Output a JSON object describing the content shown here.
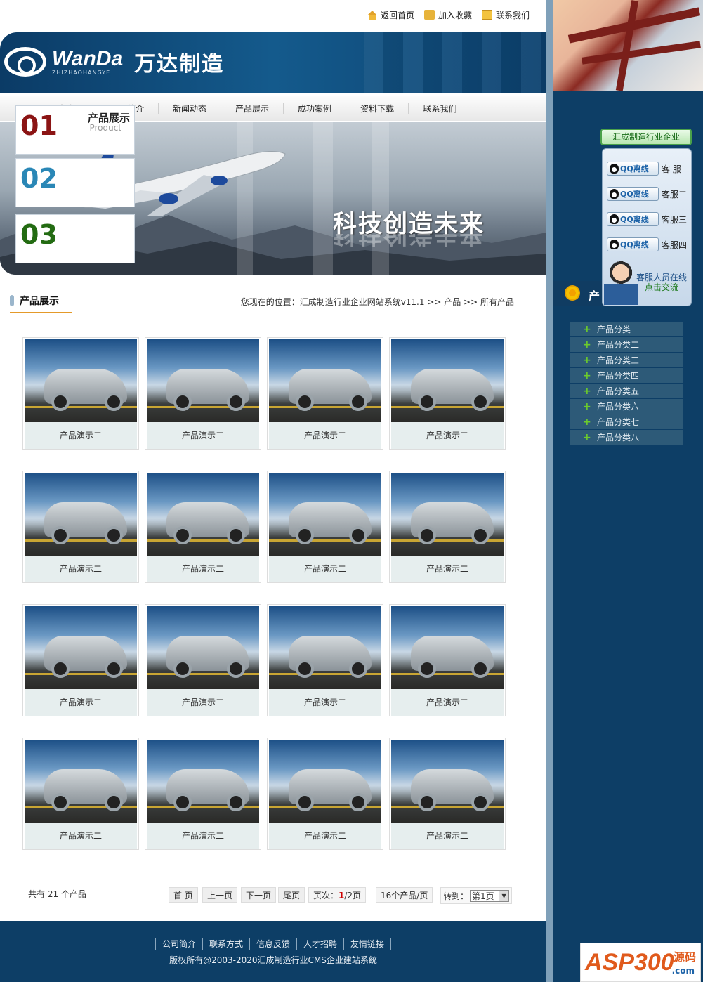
{
  "topbar": {
    "home": "返回首页",
    "favorite": "加入收藏",
    "contact": "联系我们"
  },
  "logo": {
    "en": "WanDa",
    "sub": "ZHIZHAOHANGYE",
    "cn": "万达制造"
  },
  "nav": [
    "网站首页",
    "公司简介",
    "新闻动态",
    "产品展示",
    "成功案例",
    "资料下载",
    "联系我们"
  ],
  "banner": {
    "slogan": "科技创造未来"
  },
  "section": {
    "title": "产品展示",
    "breadcrumb": "您现在的位置：汇成制造行业企业网站系统v11.1 >> 产品 >> 所有产品"
  },
  "products": [
    {
      "name": "产品演示二"
    },
    {
      "name": "产品演示二"
    },
    {
      "name": "产品演示二"
    },
    {
      "name": "产品演示二"
    },
    {
      "name": "产品演示二"
    },
    {
      "name": "产品演示二"
    },
    {
      "name": "产品演示二"
    },
    {
      "name": "产品演示二"
    },
    {
      "name": "产品演示二"
    },
    {
      "name": "产品演示二"
    },
    {
      "name": "产品演示二"
    },
    {
      "name": "产品演示二"
    },
    {
      "name": "产品演示二"
    },
    {
      "name": "产品演示二"
    },
    {
      "name": "产品演示二"
    },
    {
      "name": "产品演示二"
    }
  ],
  "pager": {
    "total": "共有 21 个产品",
    "first": "首 页",
    "prev": "上一页",
    "next": "下一页",
    "last": "尾页",
    "page_label": "页次：",
    "current": "1",
    "total_pages": "/2页",
    "per_page": "16个产品/页",
    "jump_label": "转到：",
    "jump_value": "第1页"
  },
  "footer": {
    "links": [
      "公司简介",
      "联系方式",
      "信息反馈",
      "人才招聘",
      "友情链接"
    ],
    "copyright": "版权所有@2003-2020汇成制造行业CMS企业建站系统"
  },
  "sidebar": {
    "cards": [
      {
        "num": "01",
        "color": "#8b1414"
      },
      {
        "num": "02",
        "color": "#2a87b6"
      },
      {
        "num": "03",
        "color": "#236b12"
      }
    ],
    "card_title": "产品展示",
    "card_en": "Product",
    "qq_header": "汇成制造行业企业",
    "qq_rows": [
      {
        "btn": "QQ离线",
        "name": "客 服"
      },
      {
        "btn": "QQ离线",
        "name": "客服二"
      },
      {
        "btn": "QQ离线",
        "name": "客服三"
      },
      {
        "btn": "QQ离线",
        "name": "客服四"
      }
    ],
    "agent_line1": "客服人员在线",
    "agent_line2": "点击交流",
    "cat_head": "产",
    "categories": [
      "产品分类一",
      "产品分类二",
      "产品分类三",
      "产品分类四",
      "产品分类五",
      "产品分类六",
      "产品分类七",
      "产品分类八"
    ]
  },
  "watermark": {
    "brand": "ASP300",
    "cn": "源码",
    ".com": ".com"
  }
}
